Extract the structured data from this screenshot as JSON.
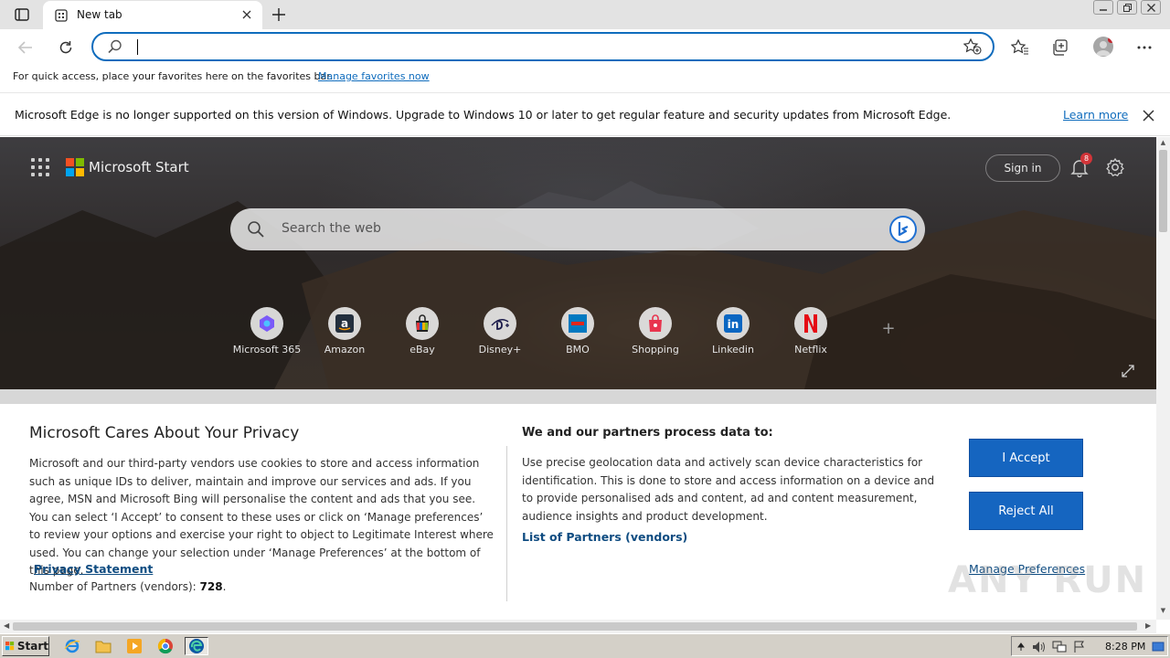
{
  "tab": {
    "title": "New tab",
    "icon": "newtab-icon"
  },
  "address": {
    "value": "",
    "placeholder": ""
  },
  "favorites_bar": {
    "text": "For quick access, place your favorites here on the favorites bar.",
    "link": "Manage favorites now"
  },
  "infobar": {
    "message": "Microsoft Edge is no longer supported on this version of Windows. Upgrade to Windows 10 or later to get regular feature and security updates from Microsoft Edge.",
    "link": "Learn more"
  },
  "start": {
    "brand": "Microsoft Start",
    "sign_in": "Sign in",
    "notifications": "8",
    "search_placeholder": "Search the web",
    "tiles": [
      {
        "label": "Microsoft 365",
        "icon": "microsoft365-icon"
      },
      {
        "label": "Amazon",
        "icon": "amazon-icon"
      },
      {
        "label": "eBay",
        "icon": "ebay-icon"
      },
      {
        "label": "Disney+",
        "icon": "disney-icon"
      },
      {
        "label": "BMO",
        "icon": "bmo-icon"
      },
      {
        "label": "Shopping",
        "icon": "shopping-icon"
      },
      {
        "label": "Linkedin",
        "icon": "linkedin-icon"
      },
      {
        "label": "Netflix",
        "icon": "netflix-icon"
      }
    ]
  },
  "privacy": {
    "title": "Microsoft Cares About Your Privacy",
    "body": "Microsoft and our third-party vendors use cookies to store and access information such as unique IDs to deliver, maintain and improve our services and ads. If you agree, MSN and Microsoft Bing will personalise the content and ads that you see. You can select ‘I Accept’ to consent to these uses or click on ‘Manage preferences’ to review your options and exercise your right to object to Legitimate Interest where used.  You can change your selection under ‘Manage Preferences’ at the bottom of this page.",
    "privacy_link": "Privacy Statement",
    "partners_label": "Number of Partners (vendors):",
    "partners_count": "728",
    "process_title": "We and our partners process data to:",
    "process_body": "Use precise geolocation data and actively scan device characteristics for identification. This is done to store and access information on a device and to provide personalised ads and content, ad and content measurement, audience insights and product development.",
    "partners_link": "List of Partners (vendors)",
    "accept": "I Accept",
    "reject": "Reject All",
    "manage": "Manage Preferences"
  },
  "watermark": "ANY RUN",
  "taskbar": {
    "start": "Start",
    "time": "8:28 PM"
  },
  "colors": {
    "accent": "#0f6cbd",
    "button": "#1565c0",
    "link": "#0f4c81"
  }
}
